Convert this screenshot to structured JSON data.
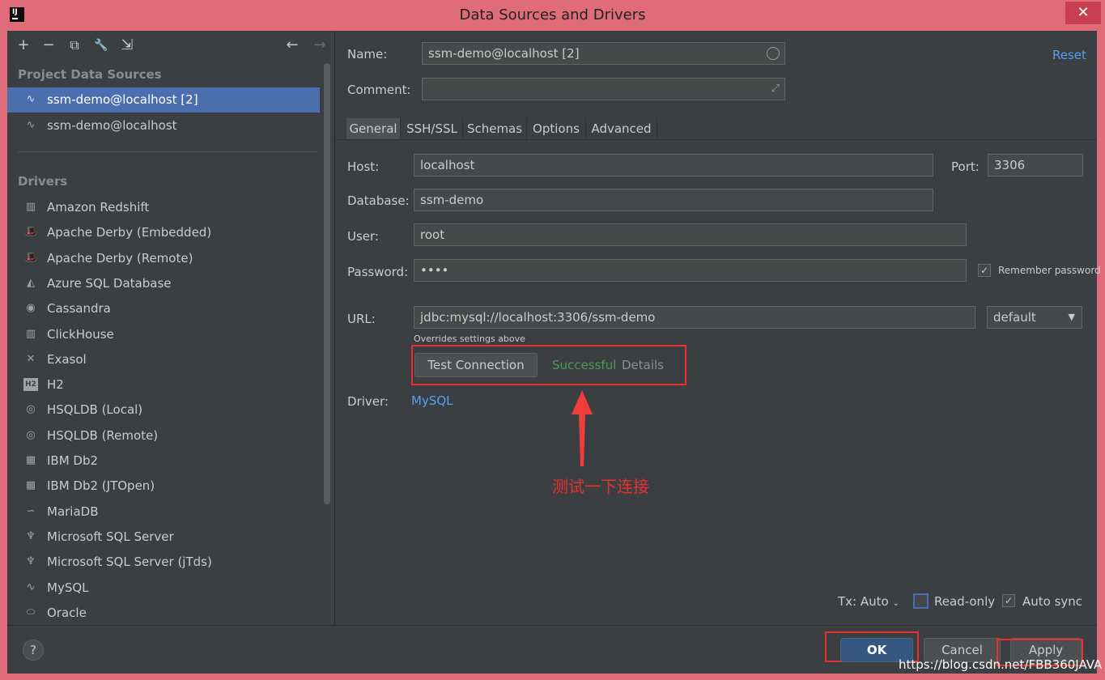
{
  "window": {
    "title": "Data Sources and Drivers",
    "close_glyph": "✕",
    "app_icon_text": "IJ"
  },
  "toolbar": {
    "icons": [
      "add-icon",
      "remove-icon",
      "duplicate-icon",
      "settings-wrench-icon",
      "import-icon",
      "back-arrow-icon",
      "forward-arrow-icon"
    ],
    "glyphs": {
      "add": "+",
      "remove": "−",
      "duplicate": "⧉",
      "wrench": "🔧",
      "import": "⇲",
      "back": "←",
      "forward": "→"
    }
  },
  "left": {
    "project_header": "Project Data Sources",
    "data_sources": [
      {
        "label": "ssm-demo@localhost [2]",
        "icon": "mysql-icon"
      },
      {
        "label": "ssm-demo@localhost",
        "icon": "mysql-icon"
      }
    ],
    "drivers_header": "Drivers",
    "drivers": [
      {
        "label": "Amazon Redshift",
        "glyph": "▥"
      },
      {
        "label": "Apache Derby (Embedded)",
        "glyph": "🎩"
      },
      {
        "label": "Apache Derby (Remote)",
        "glyph": "🎩"
      },
      {
        "label": "Azure SQL Database",
        "glyph": "◭"
      },
      {
        "label": "Cassandra",
        "glyph": "◉"
      },
      {
        "label": "ClickHouse",
        "glyph": "▥"
      },
      {
        "label": "Exasol",
        "glyph": "✕"
      },
      {
        "label": "H2",
        "glyph": "H2"
      },
      {
        "label": "HSQLDB (Local)",
        "glyph": "◎"
      },
      {
        "label": "HSQLDB (Remote)",
        "glyph": "◎"
      },
      {
        "label": "IBM Db2",
        "glyph": "▦"
      },
      {
        "label": "IBM Db2 (JTOpen)",
        "glyph": "▦"
      },
      {
        "label": "MariaDB",
        "glyph": "∽"
      },
      {
        "label": "Microsoft SQL Server",
        "glyph": "♆"
      },
      {
        "label": "Microsoft SQL Server (jTds)",
        "glyph": "♆"
      },
      {
        "label": "MySQL",
        "glyph": "∿"
      },
      {
        "label": "Oracle",
        "glyph": "⬭"
      }
    ]
  },
  "form": {
    "name_label": "Name:",
    "name_value": "ssm-demo@localhost [2]",
    "comment_label": "Comment:",
    "comment_value": "",
    "reset_label": "Reset",
    "tabs": [
      "General",
      "SSH/SSL",
      "Schemas",
      "Options",
      "Advanced"
    ],
    "host_label": "Host:",
    "host_value": "localhost",
    "port_label": "Port:",
    "port_value": "3306",
    "database_label": "Database:",
    "database_value": "ssm-demo",
    "user_label": "User:",
    "user_value": "root",
    "password_label": "Password:",
    "password_value": "••••",
    "remember_label": "Remember password",
    "url_label": "URL:",
    "url_value": "jdbc:mysql://localhost:3306/ssm-demo",
    "url_mode": "default",
    "overrides_note": "Overrides settings above",
    "test_button": "Test Connection",
    "test_status": "Successful",
    "details_label": "Details",
    "driver_label": "Driver:",
    "driver_value": "MySQL",
    "annotation": "测试一下连接"
  },
  "bottom": {
    "tx_label": "Tx: Auto",
    "readonly_label": "Read-only",
    "autosync_label": "Auto sync",
    "help_glyph": "?",
    "ok_label": "OK",
    "cancel_label": "Cancel",
    "apply_label": "Apply",
    "watermark": "https://blog.csdn.net/FBB360JAVA"
  },
  "colors": {
    "accent": "#4b6eaf",
    "link": "#589df6",
    "success": "#499c54",
    "annotation": "#e83030",
    "title_bar": "#e06c7a"
  }
}
